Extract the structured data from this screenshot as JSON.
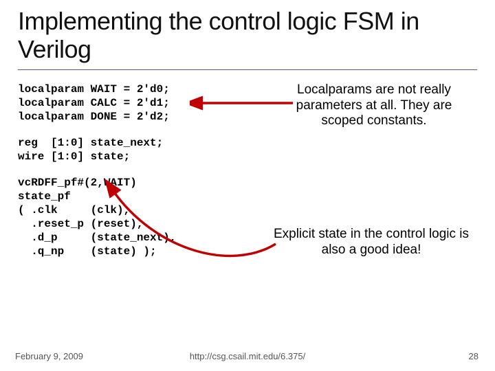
{
  "title": "Implementing the control logic FSM in Verilog",
  "code": {
    "block1": "localparam WAIT = 2'd0;\nlocalparam CALC = 2'd1;\nlocalparam DONE = 2'd2;",
    "block2": "reg  [1:0] state_next;\nwire [1:0] state;",
    "block3": "vcRDFF_pf#(2,WAIT)\nstate_pf\n( .clk     (clk),\n  .reset_p (reset),\n  .d_p     (state_next),\n  .q_np    (state) );"
  },
  "annotations": {
    "a1": "Localparams are not really parameters at all. They are scoped constants.",
    "a2": "Explicit state in the control logic is also a good idea!"
  },
  "footer": {
    "date": "February 9, 2009",
    "url": "http://csg.csail.mit.edu/6.375/",
    "page": "28"
  }
}
